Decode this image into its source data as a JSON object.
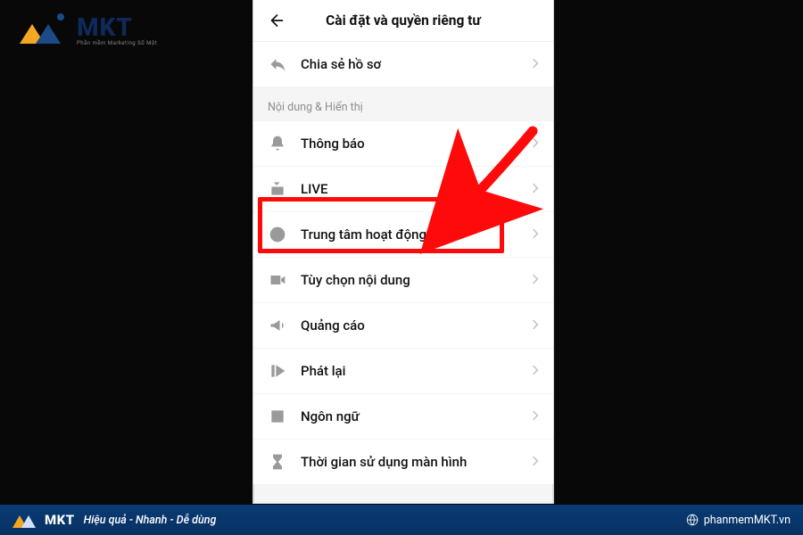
{
  "brand": {
    "name": "MKT",
    "tagline": "Phần mềm Marketing Số Một"
  },
  "phone": {
    "title": "Cài đặt và quyền riêng tư",
    "share_profile": "Chia sẻ hồ sơ",
    "section_content_display": "Nội dung & Hiển thị",
    "items": [
      {
        "label": "Thông báo"
      },
      {
        "label": "LIVE"
      },
      {
        "label": "Trung tâm hoạt động"
      },
      {
        "label": "Tùy chọn nội dung"
      },
      {
        "label": "Quảng cáo"
      },
      {
        "label": "Phát lại"
      },
      {
        "label": "Ngôn ngữ"
      },
      {
        "label": "Thời gian sử dụng màn hình"
      }
    ]
  },
  "highlight": {
    "target_index": 2
  },
  "footer": {
    "slogan": "Hiệu quả - Nhanh - Dễ dùng",
    "site": "phanmemMKT.vn"
  }
}
